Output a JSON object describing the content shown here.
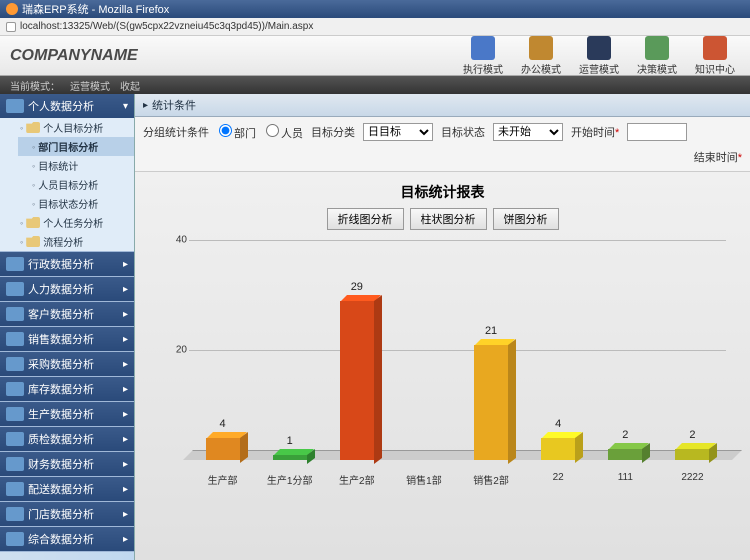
{
  "window": {
    "title": "瑞森ERP系统 - Mozilla Firefox"
  },
  "url": "localhost:13325/Web/(S(gw5cpx22vzneiu45c3q3pd45))/Main.aspx",
  "company": "COMPANYNAME",
  "topnav": [
    {
      "label": "执行模式",
      "color": "#4a78c8"
    },
    {
      "label": "办公模式",
      "color": "#c08830"
    },
    {
      "label": "运营模式",
      "color": "#2a3a5a"
    },
    {
      "label": "决策模式",
      "color": "#5a9a5a"
    },
    {
      "label": "知识中心",
      "color": "#cc5533"
    }
  ],
  "statusbar": {
    "mode_label": "当前模式：",
    "mode_value": "运营模式",
    "action": "收起"
  },
  "sidebar": {
    "first": {
      "label": "个人数据分析"
    },
    "tree_root": "个人目标分析",
    "tree_items": [
      "部门目标分析",
      "目标统计",
      "人员目标分析",
      "目标状态分析"
    ],
    "tree_extra": [
      "个人任务分析",
      "流程分析"
    ],
    "groups": [
      "行政数据分析",
      "人力数据分析",
      "客户数据分析",
      "销售数据分析",
      "采购数据分析",
      "库存数据分析",
      "生产数据分析",
      "质检数据分析",
      "财务数据分析",
      "配送数据分析",
      "门店数据分析",
      "综合数据分析"
    ]
  },
  "panel": {
    "title": "统计条件"
  },
  "filter": {
    "group_label": "分组统计条件",
    "radio_dept": "部门",
    "radio_person": "人员",
    "class_label": "目标分类",
    "class_value": "日目标",
    "status_label": "目标状态",
    "status_value": "未开始",
    "start_label": "开始时间",
    "end_label": "结束时间"
  },
  "chart_title": "目标统计报表",
  "chart_tabs": [
    "折线图分析",
    "柱状图分析",
    "饼图分析"
  ],
  "chart_data": {
    "type": "bar",
    "title": "目标统计报表",
    "categories": [
      "生产部",
      "生产1分部",
      "生产2部",
      "销售1部",
      "销售2部",
      "22",
      "111",
      "2222"
    ],
    "values": [
      4,
      1,
      29,
      0,
      21,
      4,
      2,
      2
    ],
    "colors": [
      "#e08820",
      "#3aa03a",
      "#d84818",
      "#aaaaaa",
      "#e8a820",
      "#e8c820",
      "#6aa03a",
      "#b8b820"
    ],
    "ylabel": "",
    "xlabel": "",
    "ylim": [
      0,
      40
    ],
    "yticks": [
      20,
      40
    ]
  }
}
